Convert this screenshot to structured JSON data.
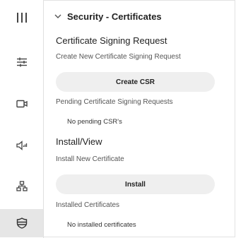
{
  "sidebar": {
    "items": [
      {
        "icon": "columns-icon"
      },
      {
        "icon": "sliders-icon"
      },
      {
        "icon": "camera-icon"
      },
      {
        "icon": "speaker-icon"
      },
      {
        "icon": "network-icon"
      },
      {
        "icon": "shield-icon",
        "active": true
      }
    ]
  },
  "section": {
    "title": "Security - Certificates"
  },
  "csr": {
    "heading": "Certificate Signing Request",
    "create_label": "Create New Certificate Signing Request",
    "create_button": "Create CSR",
    "pending_label": "Pending Certificate Signing Requests",
    "pending_empty": "No pending CSR's"
  },
  "install": {
    "heading": "Install/View",
    "install_label": "Install New Certificate",
    "install_button": "Install",
    "installed_label": "Installed Certificates",
    "installed_empty": "No installed certificates"
  },
  "colors": {
    "sidebar_active": "#e6e6e6",
    "pill_bg": "#efefef",
    "border": "#e0e0e0"
  }
}
